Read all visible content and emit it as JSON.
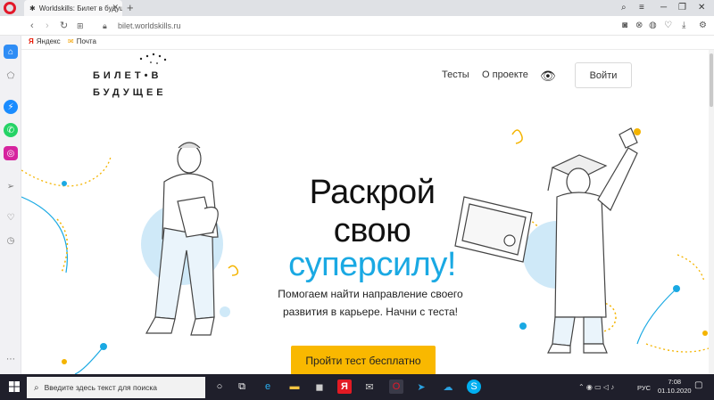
{
  "browser": {
    "tab_title": "Worldskills: Билет в будущ...",
    "tab_favicon": "worldskills-favicon",
    "url": "bilet.worldskills.ru",
    "bookmarks": [
      {
        "label": "Яндекс",
        "icon": "yandex-icon"
      },
      {
        "label": "Почта",
        "icon": "mail-icon"
      }
    ]
  },
  "site": {
    "logo_line1": "БИЛЕТ•В",
    "logo_line2": "БУДУЩЕЕ",
    "nav": [
      "Тесты",
      "О проекте"
    ],
    "login_label": "Войти",
    "headline": [
      "Раскрой",
      "свою",
      "суперсилу!"
    ],
    "subtitle": [
      "Помогаем найти направление своего",
      "развития в карьере. Начни с теста!"
    ],
    "cta_label": "Пройти тест бесплатно",
    "accent": "#1aa9e3",
    "cta_color": "#f9b800"
  },
  "taskbar": {
    "search_placeholder": "Введите здесь текст для поиска",
    "lang": "РУС",
    "time": "7:08",
    "date": "01.10.2020"
  }
}
